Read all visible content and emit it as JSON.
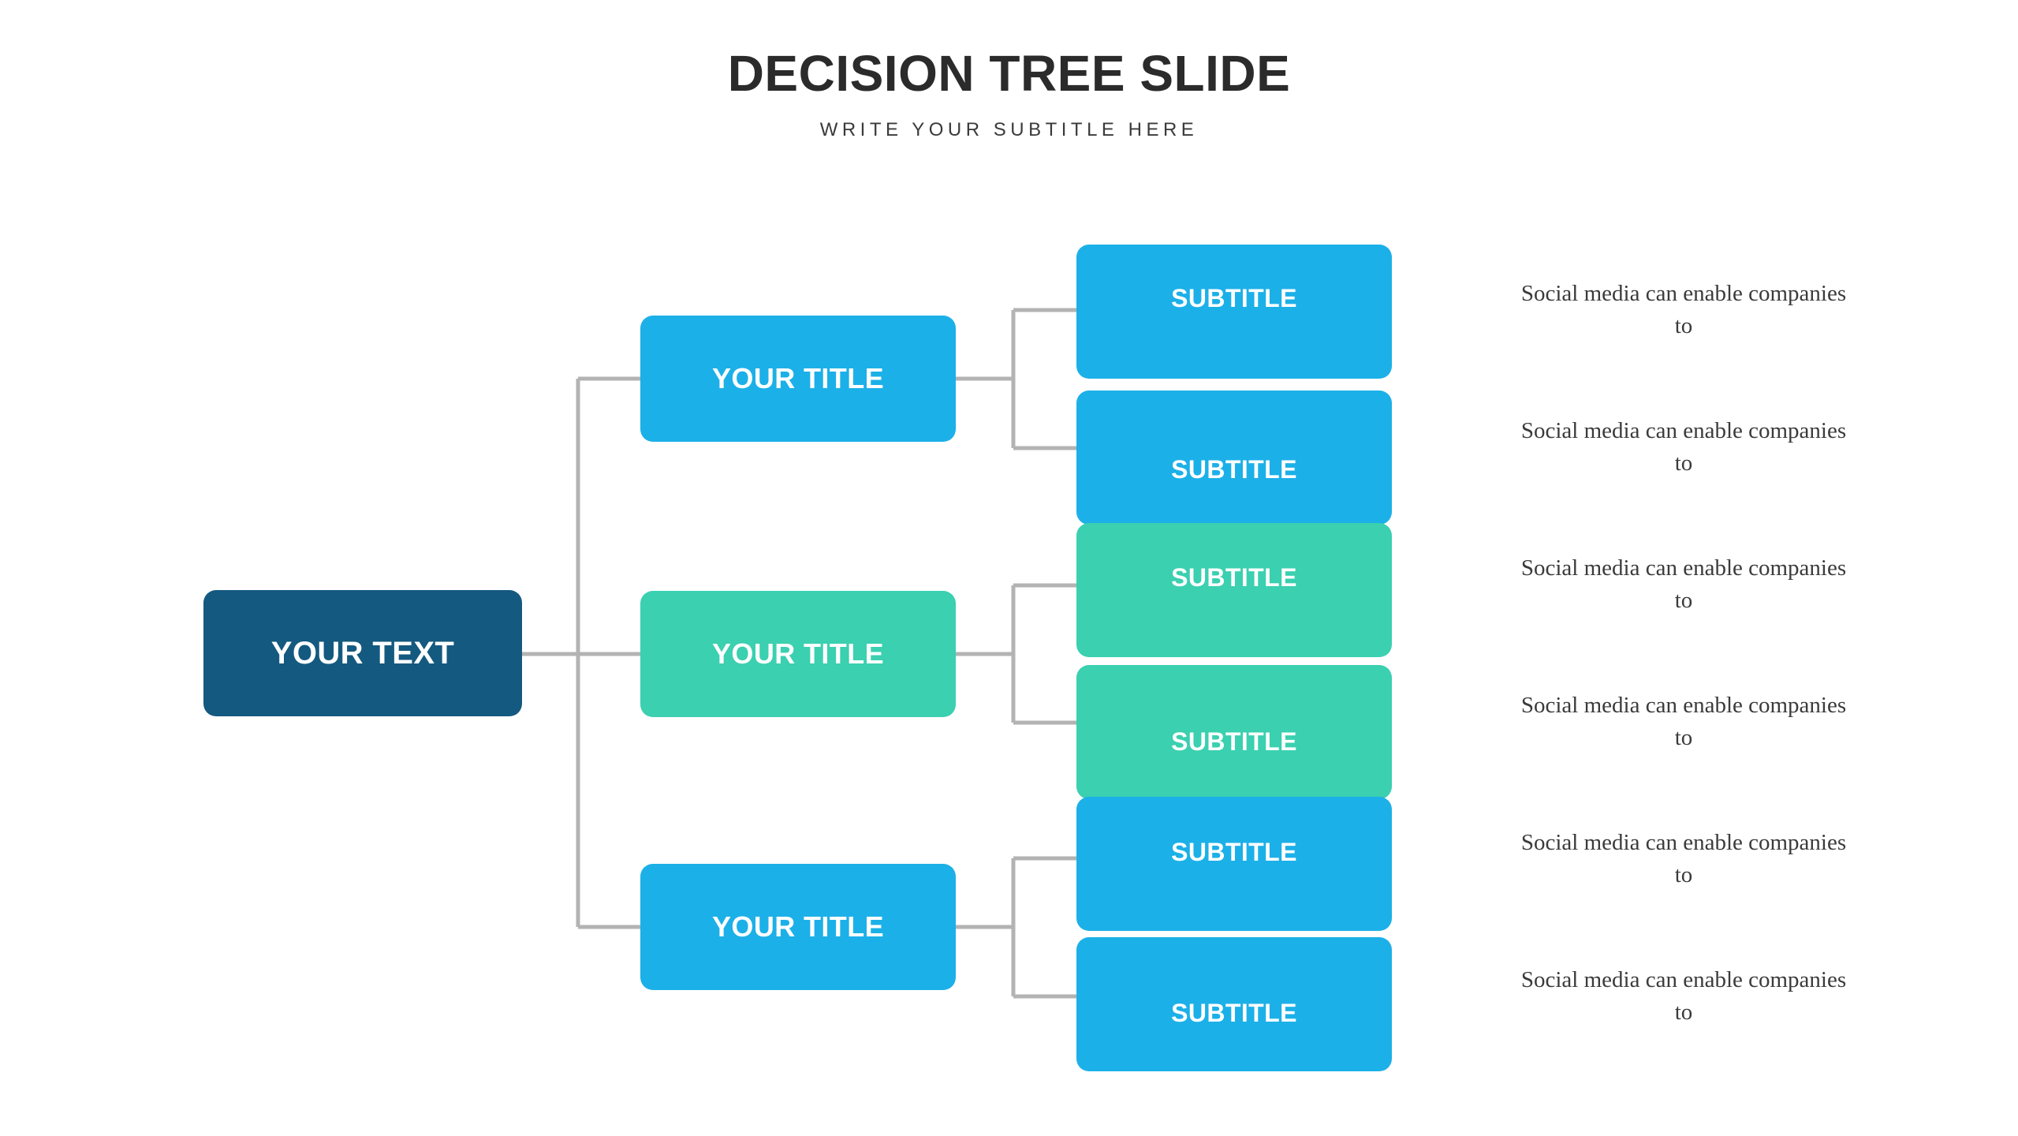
{
  "header": {
    "title": "DECISION TREE SLIDE",
    "subtitle": "WRITE YOUR SUBTITLE HERE"
  },
  "colors": {
    "background": "#ffffff",
    "root": "#14597f",
    "blue": "#1cb0e8",
    "teal": "#3ad0b0",
    "connector": "#b3b3b3",
    "title_text": "#2b2b2b",
    "body_text": "#3b3b3b",
    "node_text": "#ffffff"
  },
  "tree": {
    "root": {
      "label": "YOUR TEXT",
      "color_key": "root"
    },
    "branches": [
      {
        "label": "YOUR TITLE",
        "color_key": "blue",
        "leaves": [
          {
            "label": "SUBTITLE",
            "color_key": "blue",
            "description": "Social media can enable companies to"
          },
          {
            "label": "SUBTITLE",
            "color_key": "blue",
            "description": "Social media can enable companies to"
          }
        ]
      },
      {
        "label": "YOUR TITLE",
        "color_key": "teal",
        "leaves": [
          {
            "label": "SUBTITLE",
            "color_key": "teal",
            "description": "Social media can enable companies to"
          },
          {
            "label": "SUBTITLE",
            "color_key": "teal",
            "description": "Social media can enable companies to"
          }
        ]
      },
      {
        "label": "YOUR TITLE",
        "color_key": "blue",
        "leaves": [
          {
            "label": "SUBTITLE",
            "color_key": "blue",
            "description": "Social media can enable companies to"
          },
          {
            "label": "SUBTITLE",
            "color_key": "blue",
            "description": "Social media can enable companies to"
          }
        ]
      }
    ]
  }
}
